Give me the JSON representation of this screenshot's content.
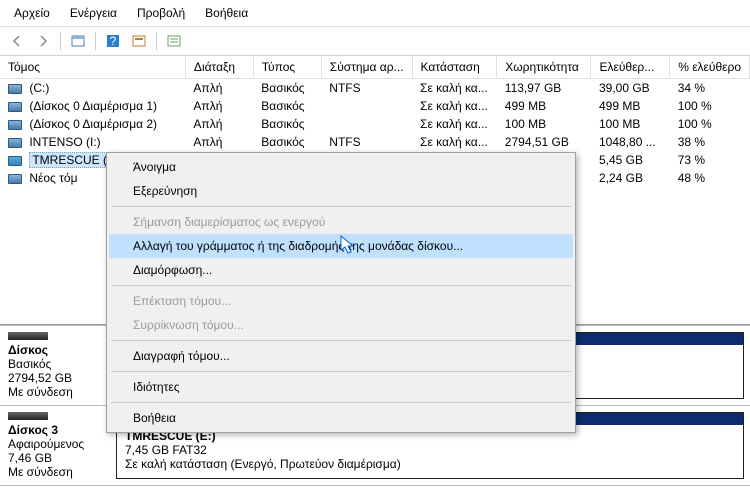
{
  "menu": {
    "file": "Αρχείο",
    "action": "Ενέργεια",
    "view": "Προβολή",
    "help": "Βοήθεια"
  },
  "cols": {
    "volume": "Τόμος",
    "layout": "Διάταξη",
    "type": "Τύπος",
    "fs": "Σύστημα αρ...",
    "status": "Κατάσταση",
    "capacity": "Χωρητικότητα",
    "free": "Ελεύθερ...",
    "pfree": "% ελεύθερο"
  },
  "rows": [
    {
      "name": "(C:)",
      "layout": "Απλή",
      "type": "Βασικός",
      "fs": "NTFS",
      "status": "Σε καλή κα...",
      "cap": "113,97 GB",
      "free": "39,00 GB",
      "pf": "34 %"
    },
    {
      "name": "(Δίσκος 0 Διαμέρισμα 1)",
      "layout": "Απλή",
      "type": "Βασικός",
      "fs": "",
      "status": "Σε καλή κα...",
      "cap": "499 MB",
      "free": "499 MB",
      "pf": "100 %"
    },
    {
      "name": "(Δίσκος 0 Διαμέρισμα 2)",
      "layout": "Απλή",
      "type": "Βασικός",
      "fs": "",
      "status": "Σε καλή κα...",
      "cap": "100 MB",
      "free": "100 MB",
      "pf": "100 %"
    },
    {
      "name": "INTENSO (I:)",
      "layout": "Απλή",
      "type": "Βασικός",
      "fs": "NTFS",
      "status": "Σε καλή κα...",
      "cap": "2794,51 GB",
      "free": "1048,80 ...",
      "pf": "38 %"
    },
    {
      "name": "TMRESCUE (E:)",
      "layout": "",
      "type": "",
      "fs": "",
      "status": "",
      "cap": "",
      "free": "5,45 GB",
      "pf": "73 %"
    },
    {
      "name": "Νέος τόμ",
      "layout": "",
      "type": "",
      "fs": "",
      "status": "",
      "cap": "",
      "free": "2,24 GB",
      "pf": "48 %"
    }
  ],
  "ctx": {
    "open": "Άνοιγμα",
    "explore": "Εξερεύνηση",
    "mark_active": "Σήμανση διαμερίσματος ως ενεργού",
    "change_letter": "Αλλαγή  του γράμματος ή της διαδρομής της μονάδας δίσκου...",
    "format": "Διαμόρφωση...",
    "extend": "Επέκταση τόμου...",
    "shrink": "Συρρίκνωση τόμου...",
    "delete": "Διαγραφή τόμου...",
    "props": "Ιδιότητες",
    "help": "Βοήθεια"
  },
  "disks": {
    "d1": {
      "title": "Δίσκος ",
      "type": "Βασικός",
      "size": "2794,52 GB",
      "status": "Με σύνδεση"
    },
    "d3": {
      "title": "Δίσκος 3",
      "type": "Αφαιρούμενος",
      "size": "7,46 GB",
      "status": "Με σύνδεση",
      "part_title": "TMRESCUE  (E:)",
      "part_sub": "7,45 GB FAT32",
      "part_status": "Σε καλή κατάσταση (Ενεργό, Πρωτεύον διαμέρισμα)"
    }
  }
}
